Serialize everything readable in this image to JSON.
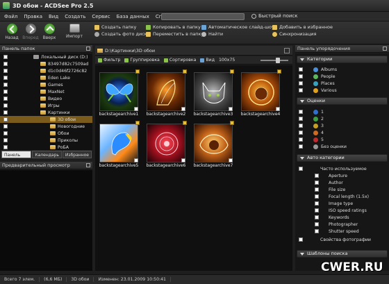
{
  "window": {
    "title": "3D обои - ACDSee Pro 2.5"
  },
  "menu": {
    "items": [
      "Файл",
      "Правка",
      "Вид",
      "Создать",
      "Сервис",
      "База данных",
      "Справка"
    ],
    "quick_search": "Быстрый поиск"
  },
  "toolbar": {
    "back": "Назад",
    "forward": "Вперед",
    "up": "Вверх",
    "import": "Импорт",
    "actions_col1": [
      "Создать папку",
      "Создать фото диск"
    ],
    "actions_col2": [
      "Копировать в папку",
      "Переместить в папку"
    ],
    "actions_col3": [
      "Автоматическое слайд-шоу",
      "Найти"
    ],
    "actions_col4": [
      "Добавить в избранное",
      "Синхронизация"
    ]
  },
  "folders_panel": {
    "title": "Панель папок",
    "items": [
      {
        "label": "Локальный диск (D:)",
        "selected": false
      },
      {
        "label": "83497d82c7509ad",
        "selected": false
      },
      {
        "label": "d1c0d46f2726c82",
        "selected": false
      },
      {
        "label": "Eden Lake",
        "selected": false
      },
      {
        "label": "Games",
        "selected": false
      },
      {
        "label": "MaxNet",
        "selected": false
      },
      {
        "label": "Видео",
        "selected": false
      },
      {
        "label": "Игры",
        "selected": false
      },
      {
        "label": "Картинки",
        "selected": false
      },
      {
        "label": "3D обои",
        "selected": true
      },
      {
        "label": "Новогодние",
        "selected": false
      },
      {
        "label": "Обои",
        "selected": false
      },
      {
        "label": "Приколы",
        "selected": false
      },
      {
        "label": "РоБА",
        "selected": false
      }
    ],
    "tabs": [
      "Панель папок",
      "Календарь",
      "Избранное"
    ]
  },
  "preview_panel": {
    "title": "Предварительный просмотр"
  },
  "browser": {
    "path": "D:\\Картинки\\3D обои",
    "filter": "Фильтр",
    "group": "Группировка",
    "sort": "Сортировка",
    "view": "Вид",
    "size": "100x75",
    "thumbnails": [
      {
        "caption": "backstagearchive1",
        "subject": "butterfly"
      },
      {
        "caption": "backstagearchive2",
        "subject": "horse"
      },
      {
        "caption": "backstagearchive3",
        "subject": "cat"
      },
      {
        "caption": "backstagearchive4",
        "subject": "lion"
      },
      {
        "caption": "backstagearchive5",
        "subject": "parrot"
      },
      {
        "caption": "backstagearchive6",
        "subject": "rose"
      },
      {
        "caption": "backstagearchive7",
        "subject": "lion"
      }
    ]
  },
  "organize_panel": {
    "title": "Панель упорядочения",
    "categories_title": "Категории",
    "categories": [
      {
        "label": "Albums",
        "color": "#4a90d9"
      },
      {
        "label": "People",
        "color": "#5cb85c"
      },
      {
        "label": "Places",
        "color": "#3aa0c0"
      },
      {
        "label": "Various",
        "color": "#e0a020"
      }
    ],
    "ratings_title": "Оценки",
    "ratings": [
      {
        "label": "1",
        "color": "#2f6fd0"
      },
      {
        "label": "2",
        "color": "#3aa040"
      },
      {
        "label": "3",
        "color": "#c8a020"
      },
      {
        "label": "4",
        "color": "#d06a20"
      },
      {
        "label": "5",
        "color": "#c02a2a"
      },
      {
        "label": "Без оценки",
        "color": "#999999"
      }
    ],
    "auto_title": "Авто категории",
    "auto_group": "Часто используемое",
    "auto_items": [
      "Aperture",
      "Author",
      "File size",
      "Focal length (1.5x)",
      "Image type",
      "ISO speed ratings",
      "Keywords",
      "Photographer",
      "Shutter speed"
    ],
    "photo_props": "Свойства фотографии",
    "saved_search": "Шаблоны поиска"
  },
  "status": {
    "total": "Всего 7 элем.",
    "size": "(6,6 МБ)",
    "folder": "3D обои",
    "modified": "Изменен: 23.01.2009 10:50:41"
  },
  "watermark": "CWER.RU"
}
